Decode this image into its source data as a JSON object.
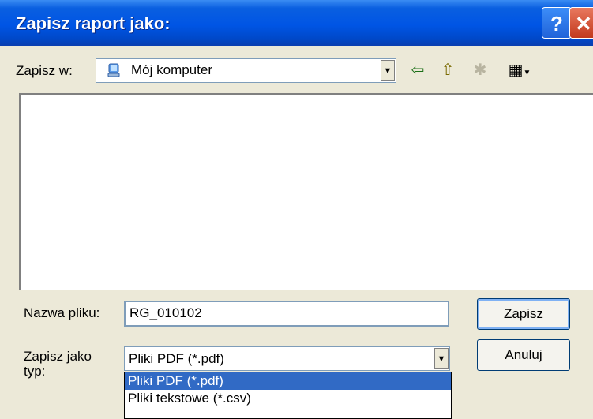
{
  "dialog": {
    "title": "Zapisz raport jako:"
  },
  "title_buttons": {
    "help": "?",
    "close": "✕"
  },
  "location": {
    "label": "Zapisz w:",
    "value": "Mój komputer"
  },
  "filename": {
    "label": "Nazwa pliku:",
    "value": "RG_010102"
  },
  "filetype": {
    "label_line1": "Zapisz jako",
    "label_line2": "typ:",
    "value": "Pliki PDF  (*.pdf)",
    "options": [
      "Pliki PDF  (*.pdf)",
      "Pliki tekstowe (*.csv)"
    ]
  },
  "buttons": {
    "save": "Zapisz",
    "cancel": "Anuluj"
  },
  "icons": {
    "back": "⇦",
    "up": "⇧",
    "new_folder": "✱",
    "view": "▦"
  }
}
